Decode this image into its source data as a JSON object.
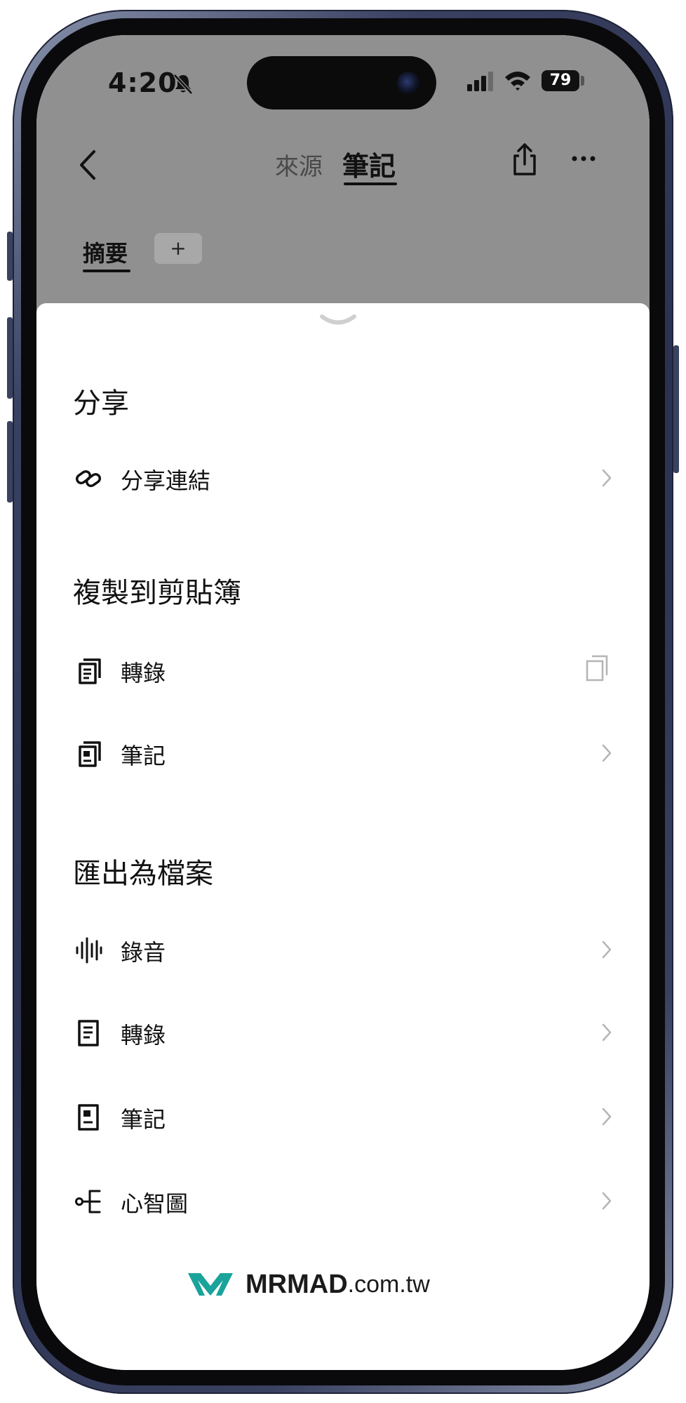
{
  "status_bar": {
    "time": "4:20",
    "battery": "79"
  },
  "nav": {
    "tab_source": "來源",
    "tab_notes": "筆記"
  },
  "sub_tabs": {
    "summary": "摘要",
    "add": "+"
  },
  "sheet": {
    "sections": [
      {
        "title": "分享",
        "items": [
          {
            "label": "分享連結",
            "icon": "link-icon",
            "action": "chevron"
          }
        ]
      },
      {
        "title": "複製到剪貼簿",
        "items": [
          {
            "label": "轉錄",
            "icon": "document-copy-icon",
            "action": "copy"
          },
          {
            "label": "筆記",
            "icon": "note-copy-icon",
            "action": "chevron"
          }
        ]
      },
      {
        "title": "匯出為檔案",
        "items": [
          {
            "label": "錄音",
            "icon": "waveform-icon",
            "action": "chevron"
          },
          {
            "label": "轉錄",
            "icon": "document-icon",
            "action": "chevron"
          },
          {
            "label": "筆記",
            "icon": "note-icon",
            "action": "chevron"
          },
          {
            "label": "心智圖",
            "icon": "mindmap-icon",
            "action": "chevron"
          }
        ]
      }
    ]
  },
  "watermark": {
    "brand": "MRMAD",
    "domain": ".com.tw"
  },
  "colors": {
    "backdrop": "#909090",
    "frame": "#2b3150",
    "logo": "#1aa39a",
    "chevron": "#b5b5b5"
  }
}
